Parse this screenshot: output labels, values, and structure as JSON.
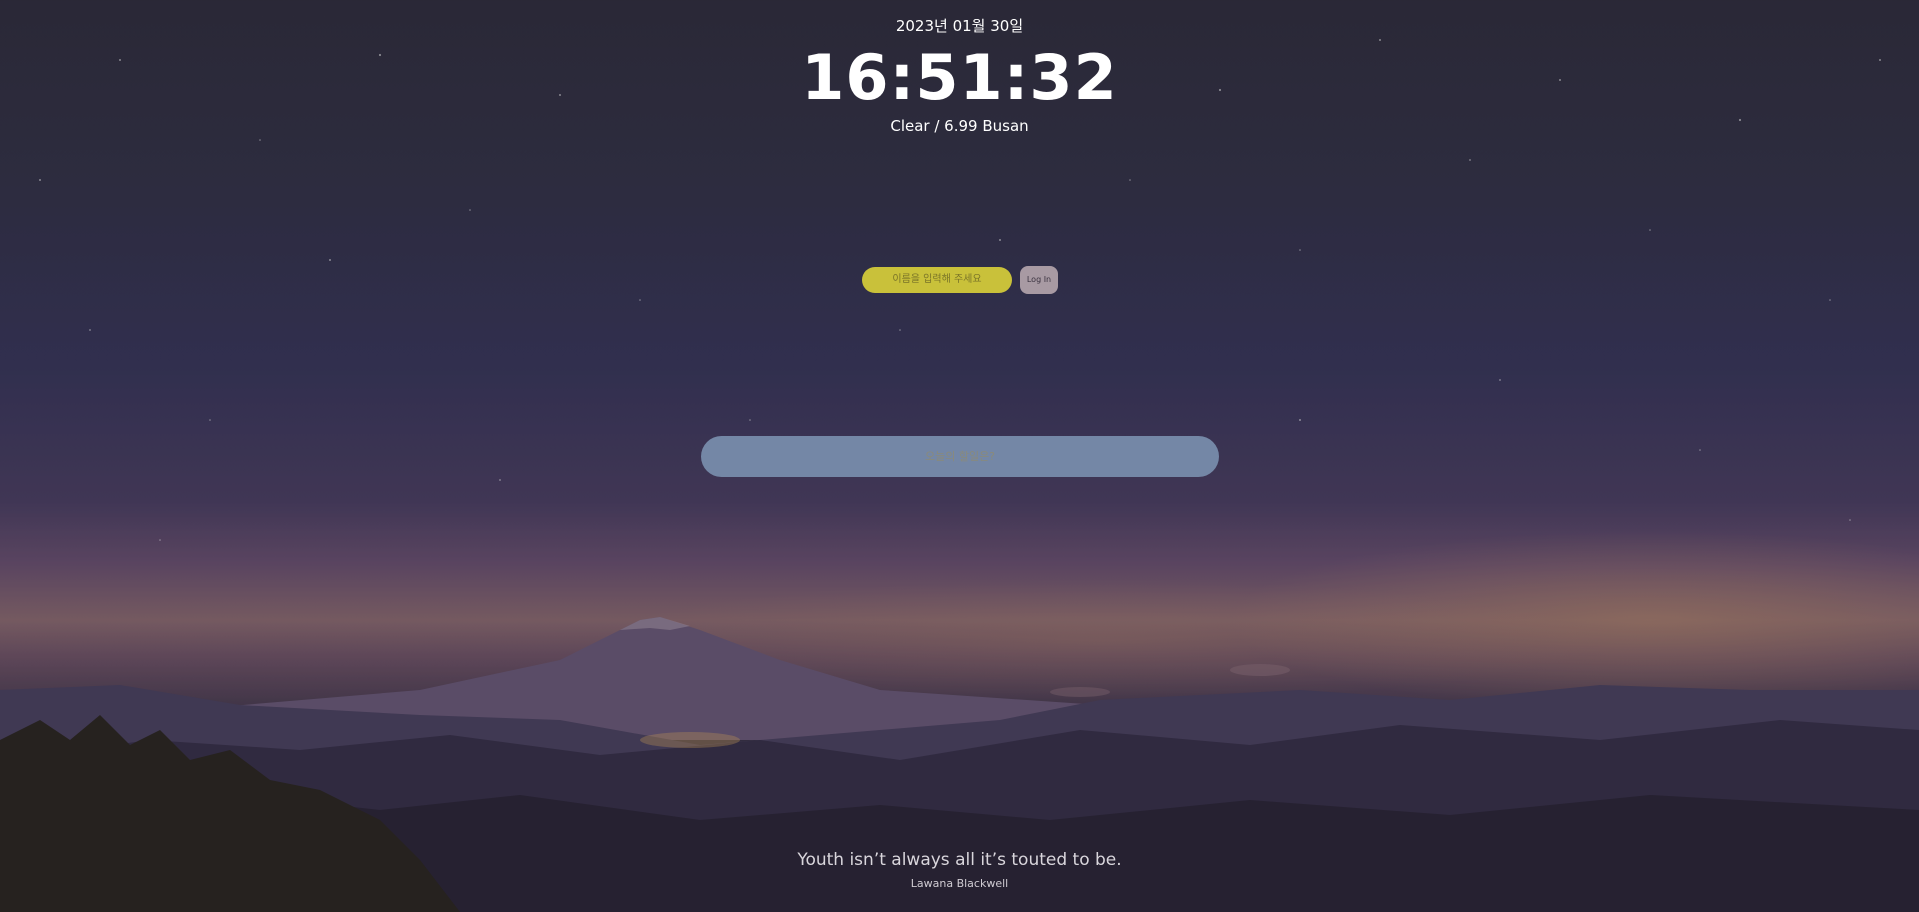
{
  "header": {
    "date": "2023년 01월 30일",
    "clock": "16:51:32",
    "weather": "Clear / 6.99 Busan"
  },
  "login": {
    "name_placeholder": "이름을 입력해 주세요",
    "login_button_label": "Log In"
  },
  "todo": {
    "placeholder": "오늘의 할일은?"
  },
  "quote": {
    "text": "Youth isn’t always all it’s touted to be.",
    "author": "Lawana Blackwell"
  },
  "colors": {
    "name_input_bg": "#c9c13a",
    "login_button_bg": "#a89aa3",
    "todo_input_bg": "#7487a6",
    "text": "#ffffff"
  },
  "background": {
    "icon": "mountain-night-sky-image"
  }
}
